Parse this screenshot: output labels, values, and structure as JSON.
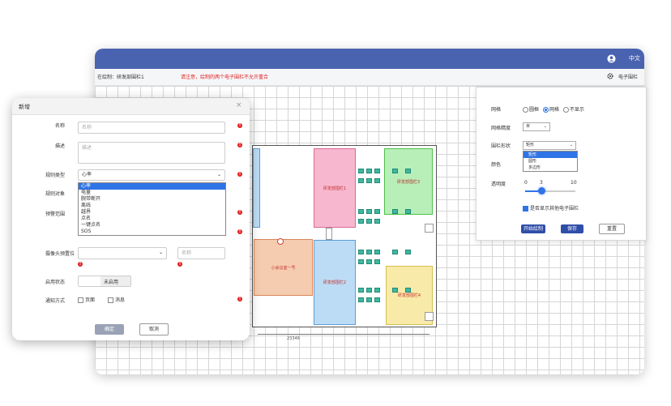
{
  "app": {
    "lang": "中文",
    "crumb": "在绘制：研发部围栏1",
    "warning": "请注意，绘制的两个电子围栏不允许重合",
    "fence_link": "电子围栏"
  },
  "rooms": {
    "rd1": "研发部围栏1",
    "rd2": "研发部围栏2",
    "rd3": "研发部围栏3",
    "rd4": "研发部围栏4",
    "meeting": "小会议室一号",
    "dimension": "23346"
  },
  "right_panel": {
    "grid_label": "网格",
    "grid_options": [
      "圆框",
      "网格",
      "不显示"
    ],
    "grid_selected": 1,
    "precision_label": "网格精度",
    "precision_value": "米",
    "shape_label": "围栏形状",
    "shape_value": "矩形",
    "shape_options": [
      "矩形",
      "圆形",
      "多边形"
    ],
    "shape_selected": 0,
    "color_label": "颜色",
    "opacity_label": "透明度",
    "opacity_min": "0",
    "opacity_value": "3",
    "opacity_max": "10",
    "show_others_label": "是否显示其他电子围栏",
    "show_others_checked": true,
    "start_btn": "开始绘制",
    "save_btn": "保存",
    "reset_btn": "重置"
  },
  "dialog": {
    "title": "新增",
    "close": "×",
    "name_label": "名称",
    "name_placeholder": "名称",
    "desc_label": "描述",
    "desc_placeholder": "描述",
    "rule_type_label": "规则类型",
    "rule_type_value": "心率",
    "rule_options": [
      "心率",
      "电量",
      "腕带断开",
      "离线",
      "越界",
      "点名",
      "一键点名",
      "SOS"
    ],
    "rule_selected": 0,
    "rule_target_label": "规则对象",
    "threshold_label": "预警范围",
    "camera_label": "摄像头预置位",
    "camera_name_placeholder": "名称",
    "status_label": "启用状态",
    "status_value": "未启用",
    "notify_label": "通知方式",
    "notify_options": [
      "页面",
      "消息"
    ],
    "confirm_btn": "确定",
    "cancel_btn": "取消"
  }
}
